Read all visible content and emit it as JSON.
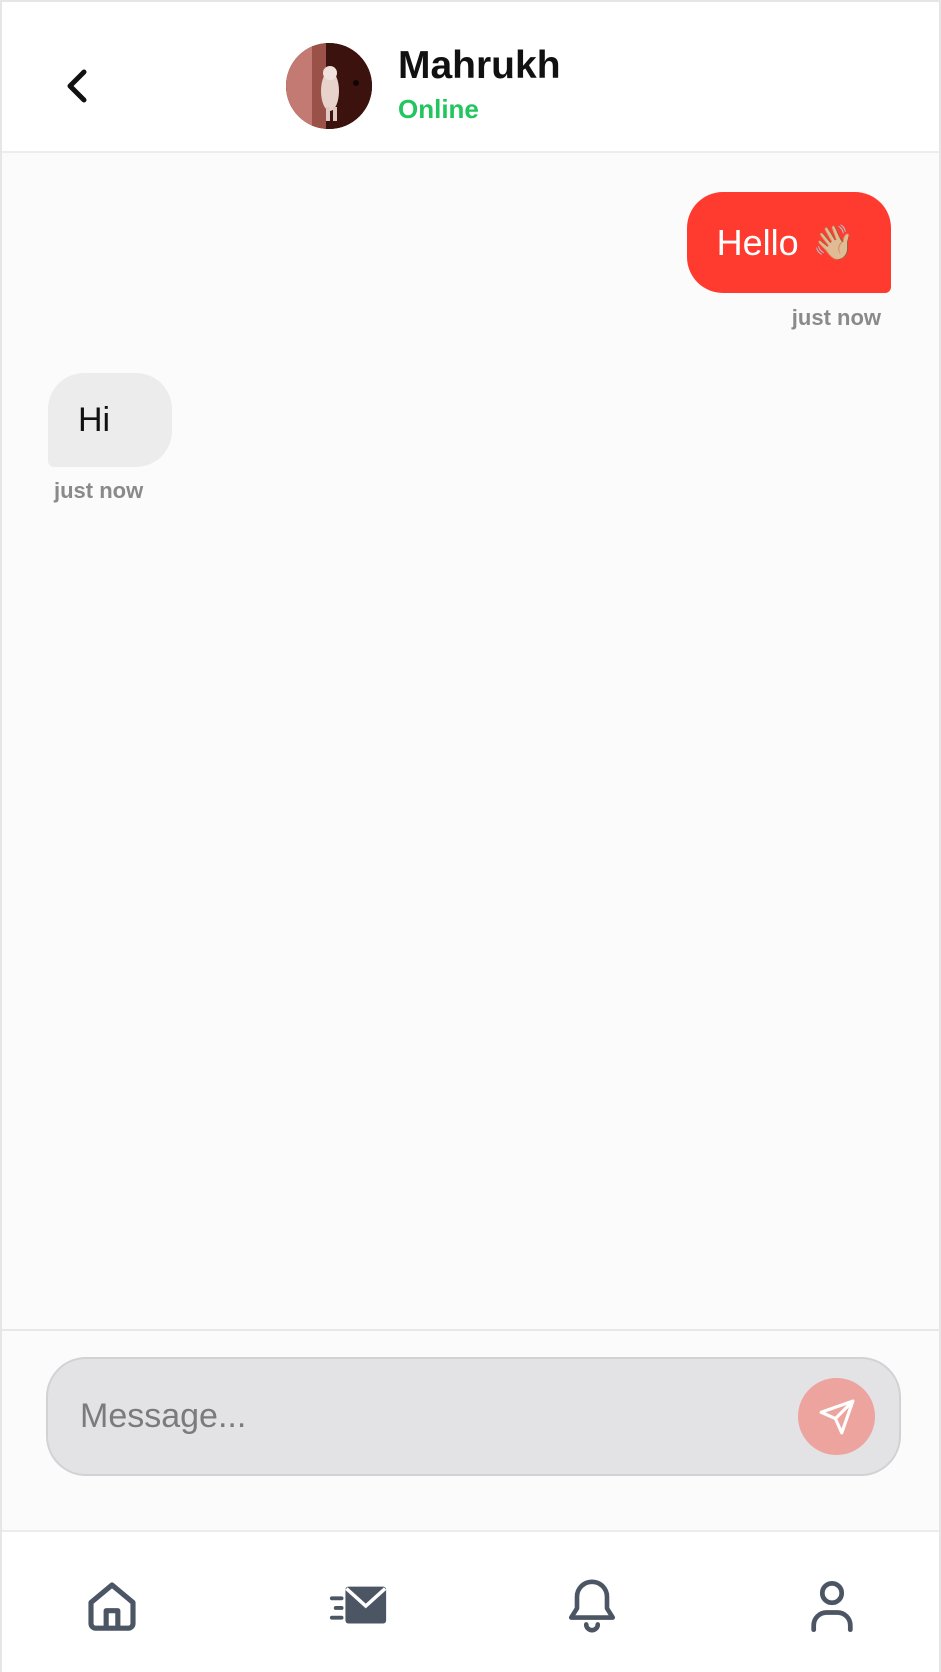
{
  "header": {
    "contact_name": "Mahrukh",
    "status": "Online",
    "status_color": "#22c55e",
    "back_icon": "chevron-left-icon",
    "avatar": "contact-photo"
  },
  "messages": [
    {
      "direction": "outgoing",
      "text": "Hello",
      "emoji": "👋🏼",
      "time": "just now",
      "bubble_color": "#ff3b30"
    },
    {
      "direction": "incoming",
      "text": "Hi",
      "time": "just now",
      "bubble_color": "#ececec"
    }
  ],
  "composer": {
    "placeholder": "Message...",
    "send_icon": "send-icon",
    "send_button_color": "#eda39e"
  },
  "bottom_nav": {
    "items": [
      {
        "icon": "home-icon"
      },
      {
        "icon": "messages-icon",
        "active": true
      },
      {
        "icon": "bell-icon"
      },
      {
        "icon": "user-icon"
      }
    ]
  }
}
